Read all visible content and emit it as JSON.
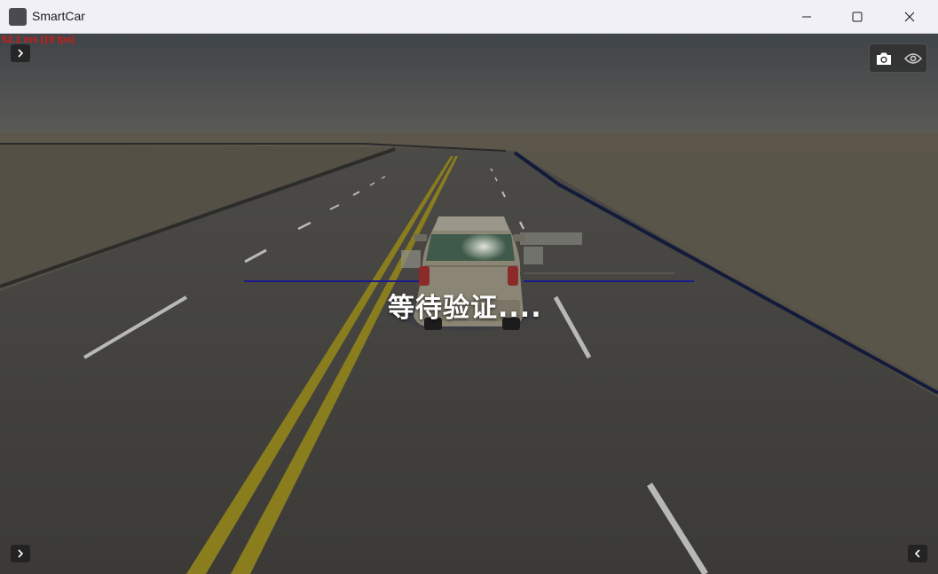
{
  "window": {
    "title": "SmartCar",
    "controls": [
      "minimize",
      "maximize",
      "close"
    ]
  },
  "viewport": {
    "fps_text": "52.1 ms (19 fps)",
    "status_text": "等待验证....",
    "toolbar": {
      "buttons": [
        {
          "icon": "camera-icon"
        },
        {
          "icon": "eye-icon"
        }
      ]
    },
    "panel_toggles": [
      {
        "position": "top-left",
        "icon": "chevron-right-icon"
      },
      {
        "position": "bottom-left",
        "icon": "chevron-right-icon"
      },
      {
        "position": "bottom-right",
        "icon": "chevron-left-icon"
      }
    ]
  },
  "colors": {
    "titlebar_bg": "#f1f0f6",
    "fps_text": "#d21a1a",
    "road_line_yellow": "#8a7d1e",
    "guide_line": "#1a1a8c",
    "toolbar_bg": "#323232"
  }
}
